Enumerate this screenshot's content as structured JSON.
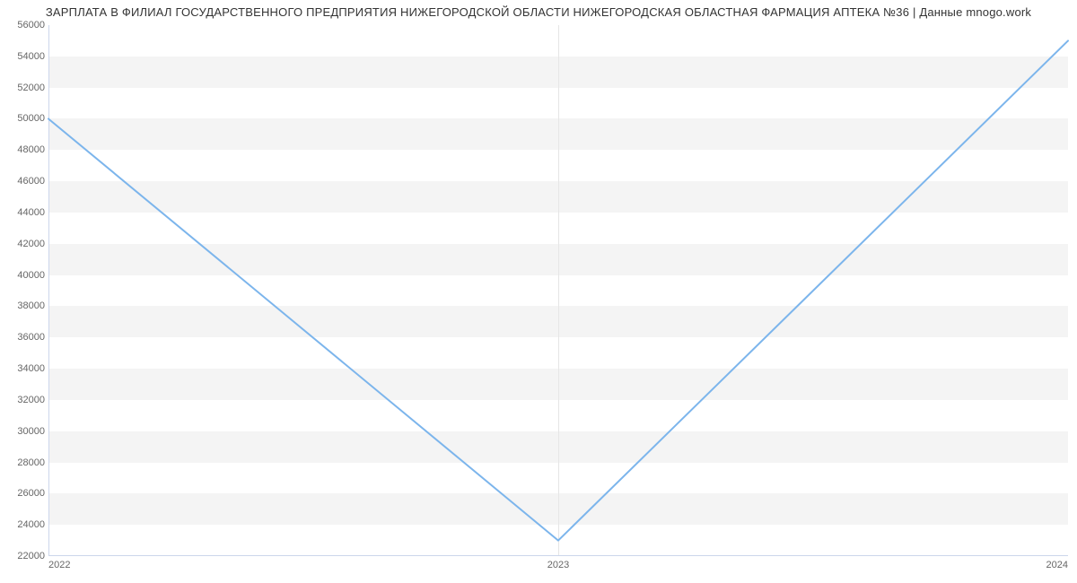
{
  "chart_data": {
    "type": "line",
    "title": "ЗАРПЛАТА В ФИЛИАЛ ГОСУДАРСТВЕННОГО ПРЕДПРИЯТИЯ НИЖЕГОРОДСКОЙ ОБЛАСТИ НИЖЕГОРОДСКАЯ ОБЛАСТНАЯ ФАРМАЦИЯ АПТЕКА №36 | Данные mnogo.work",
    "xlabel": "",
    "ylabel": "",
    "x": [
      2022,
      2023,
      2024
    ],
    "values": [
      50000,
      23000,
      55000
    ],
    "x_ticks": [
      2022,
      2023,
      2024
    ],
    "y_ticks": [
      22000,
      24000,
      26000,
      28000,
      30000,
      32000,
      34000,
      36000,
      38000,
      40000,
      42000,
      44000,
      46000,
      48000,
      50000,
      52000,
      54000,
      56000
    ],
    "xlim": [
      2022,
      2024
    ],
    "ylim": [
      22000,
      56000
    ],
    "line_color": "#7cb5ec",
    "grid": {
      "horizontal_bands": true,
      "vertical_lines": true
    }
  }
}
